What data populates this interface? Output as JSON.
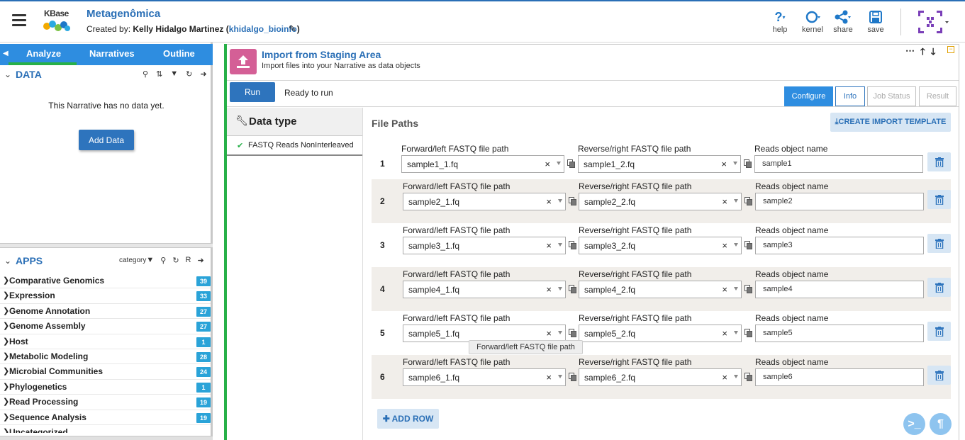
{
  "header": {
    "logo_text": "KBase",
    "title": "Metagenômica",
    "created_prefix": "Created by:",
    "author": "Kelly Hidalgo Martinez",
    "author_open": "(",
    "username": "khidalgo_bioinfo",
    "author_close": ")",
    "buttons": {
      "help": "help",
      "kernel": "kernel",
      "share": "share",
      "save": "save"
    },
    "accent_color": "#2a6fb6"
  },
  "left_panel": {
    "tabs": [
      "Analyze",
      "Narratives",
      "Outline"
    ],
    "data_section": {
      "title": "DATA",
      "empty_message": "This Narrative has no data yet.",
      "add_button": "Add Data"
    },
    "apps_section": {
      "title": "APPS",
      "sort_label": "category",
      "r_label": "R",
      "categories": [
        {
          "name": "Comparative Genomics",
          "count": "39"
        },
        {
          "name": "Expression",
          "count": "33"
        },
        {
          "name": "Genome Annotation",
          "count": "27"
        },
        {
          "name": "Genome Assembly",
          "count": "27"
        },
        {
          "name": "Host",
          "count": "1"
        },
        {
          "name": "Metabolic Modeling",
          "count": "28"
        },
        {
          "name": "Microbial Communities",
          "count": "24"
        },
        {
          "name": "Phylogenetics",
          "count": "1"
        },
        {
          "name": "Read Processing",
          "count": "19"
        },
        {
          "name": "Sequence Analysis",
          "count": "19"
        },
        {
          "name": "Uncategorized",
          "count": ""
        }
      ]
    }
  },
  "cell": {
    "title": "Import from Staging Area",
    "subtitle": "Import files into your Narrative as data objects",
    "run_button": "Run",
    "status": "Ready to run",
    "view_tabs": {
      "configure": "Configure",
      "info": "Info",
      "job_status": "Job Status",
      "result": "Result"
    },
    "data_type_header": "Data type",
    "data_type_item": "FASTQ Reads NonInterleaved",
    "file_paths_title": "File Paths",
    "create_template_button": "CREATE IMPORT TEMPLATE",
    "add_row_button": "ADD ROW",
    "column_labels": {
      "forward": "Forward/left FASTQ file path",
      "reverse": "Reverse/right FASTQ file path",
      "name": "Reads object name"
    },
    "rows": [
      {
        "num": "1",
        "forward": "sample1_1.fq",
        "reverse": "sample1_2.fq",
        "name": "sample1"
      },
      {
        "num": "2",
        "forward": "sample2_1.fq",
        "reverse": "sample2_2.fq",
        "name": "sample2"
      },
      {
        "num": "3",
        "forward": "sample3_1.fq",
        "reverse": "sample3_2.fq",
        "name": "sample3"
      },
      {
        "num": "4",
        "forward": "sample4_1.fq",
        "reverse": "sample4_2.fq",
        "name": "sample4"
      },
      {
        "num": "5",
        "forward": "sample5_1.fq",
        "reverse": "sample5_2.fq",
        "name": "sample5"
      },
      {
        "num": "6",
        "forward": "sample6_1.fq",
        "reverse": "sample6_2.fq",
        "name": "sample6"
      }
    ],
    "tooltip": "Forward/left FASTQ file path",
    "clear_glyph": "×"
  },
  "colors": {
    "primary_button": "#2e74bd",
    "tab_bar": "#2e8de0",
    "active_green": "#27b048",
    "app_icon_pink": "#d45f96",
    "count_badge": "#2aa3d8"
  }
}
